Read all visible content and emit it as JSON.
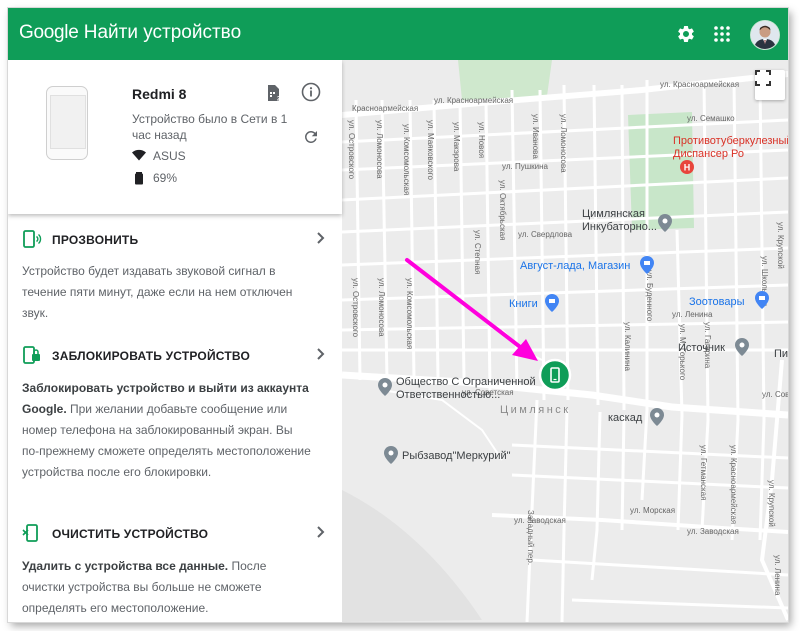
{
  "header": {
    "logo": "Google",
    "title": "Найти устройство",
    "colors": {
      "bar": "#0f9d58",
      "text": "#ffffff"
    }
  },
  "device": {
    "name": "Redmi 8",
    "status": "Устройство было в Сети в 1 час назад",
    "network": "ASUS",
    "battery": "69%"
  },
  "actions": {
    "ring": {
      "title": "ПРОЗВОНИТЬ",
      "desc": "Устройство будет издавать звуковой сигнал в течение пяти минут, даже если на нем отключен звук."
    },
    "lock": {
      "title": "ЗАБЛОКИРОВАТЬ УСТРОЙСТВО",
      "desc_bold": "Заблокировать устройство и выйти из аккаунта Google.",
      "desc": " При желании добавьте сообщение или номер телефона на заблокированный экран. Вы по-прежнему сможете определять местоположение устройства после его блокировки."
    },
    "erase": {
      "title": "ОЧИСТИТЬ УСТРОЙСТВО",
      "desc_bold": "Удалить с устройства все данные.",
      "desc": " После очистки устройства вы больше не сможете определять его местоположение."
    }
  },
  "map": {
    "streets_h": [
      "Красноармейская",
      "ул. Красноармейская",
      "ул. Красноармейская",
      "ул. Семашко",
      "ул. Пушкина",
      "ул. Свердлова",
      "ул. Ленина",
      "ул. Советская",
      "ул. Советская",
      "ул. Заводская",
      "ул. Заводская",
      "ул. Морская"
    ],
    "streets_v": [
      "ул. Островского",
      "ул. Ломоносова",
      "ул. Комсомольская",
      "ул. Маяковского",
      "ул. Макэрова",
      "ул. Новоя",
      "ул. Степная",
      "ул. Октябрьская",
      "ул. Иванова",
      "ул. Ломоносова",
      "ул. Калинина",
      "ул. Буденного",
      "ул. М. Горького",
      "ул. Гагарина",
      "ул. Школьная",
      "ул. Крупской",
      "ул. Красноармейская",
      "ул. Гетманская",
      "ул. Островского",
      "ул. Ломоносова",
      "ул. Комсомольская",
      "Западный пер.",
      "ул. Крупской",
      "ул. Ленина"
    ],
    "pois": {
      "hospital": "Противотуберкулезный Диспансер Ро",
      "incubator": "Цимлянская Инкубаторно...",
      "avgust": "Август-лада, Магазин",
      "books": "Книги",
      "zoo": "Зоотовары",
      "source": "Источник",
      "pi": "Пи",
      "company": "Общество С Ограниченной Ответственностью...",
      "kaskad": "каскад",
      "fishery": "Рыбзавод\"Меркурий\"",
      "town": "Цимлянск"
    },
    "colors": {
      "park": "#c8e6c9",
      "road": "#ffffff",
      "marker": "#0f9d58",
      "arrow": "#ff00dd"
    }
  },
  "icons": [
    "settings-icon",
    "apps-grid-icon",
    "user-avatar",
    "fullscreen-icon",
    "info-icon",
    "refresh-icon",
    "sim-icon",
    "wifi-icon",
    "battery-icon",
    "ring-phone-icon",
    "lock-phone-icon",
    "erase-phone-icon",
    "chevron-right-icon",
    "device-marker-icon"
  ]
}
